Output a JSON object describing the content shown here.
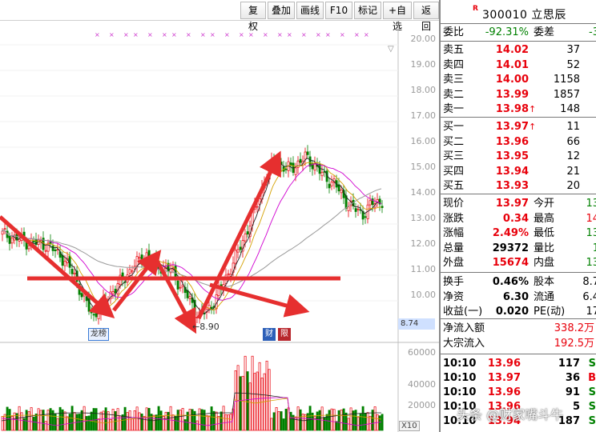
{
  "toolbar": {
    "buttons": [
      "复权",
      "叠加",
      "画线",
      "F10",
      "标记",
      "+自选",
      "返回"
    ],
    "close_glyph": "×"
  },
  "chart": {
    "price_axis": [
      "20.00",
      "19.00",
      "18.00",
      "17.00",
      "16.00",
      "15.00",
      "14.00",
      "13.00",
      "12.00",
      "11.00",
      "10.00"
    ],
    "volume_axis": [
      "60000",
      "40000",
      "20000"
    ],
    "current_price_tag": "8.74",
    "low_label": "←8.90",
    "markers": {
      "dragon": "龙榜",
      "fin": "财",
      "xian": "限"
    },
    "volume_unit": "X10",
    "watermark": "头条 @财家嘴斗牛",
    "colors": {
      "up": "#e8000b",
      "down": "#008000",
      "ma5": "#222222",
      "ma10": "#d4a000",
      "ma20": "#d000d0",
      "ma60": "#999999",
      "annotation": "#e62f2f"
    }
  },
  "quote": {
    "name": "300010 立思辰",
    "badge": "R",
    "weibi": {
      "label": "委比",
      "value": "-92.31%",
      "label2": "委差",
      "value2": "-3"
    },
    "asks": [
      {
        "label": "卖五",
        "price": "14.02",
        "vol": "37"
      },
      {
        "label": "卖四",
        "price": "14.01",
        "vol": "52"
      },
      {
        "label": "卖三",
        "price": "14.00",
        "vol": "1158"
      },
      {
        "label": "卖二",
        "price": "13.99",
        "vol": "1857"
      },
      {
        "label": "卖一",
        "price": "13.98",
        "vol": "148"
      }
    ],
    "bids": [
      {
        "label": "买一",
        "price": "13.97",
        "vol": "11"
      },
      {
        "label": "买二",
        "price": "13.96",
        "vol": "66"
      },
      {
        "label": "买三",
        "price": "13.95",
        "vol": "12"
      },
      {
        "label": "买四",
        "price": "13.94",
        "vol": "21"
      },
      {
        "label": "买五",
        "price": "13.93",
        "vol": "20"
      }
    ],
    "stats": [
      {
        "l1": "现价",
        "v1": "13.97",
        "l2": "今开",
        "v2": "13"
      },
      {
        "l1": "涨跌",
        "v1": "0.34",
        "l2": "最高",
        "v2": "14"
      },
      {
        "l1": "涨幅",
        "v1": "2.49%",
        "l2": "最低",
        "v2": "13"
      },
      {
        "l1": "总量",
        "v1": "29372",
        "l2": "量比",
        "v2": "1"
      },
      {
        "l1": "外盘",
        "v1": "15674",
        "l2": "内盘",
        "v2": "13"
      }
    ],
    "stats2": [
      {
        "l1": "换手",
        "v1": "0.46%",
        "l2": "股本",
        "v2": "8.7"
      },
      {
        "l1": "净资",
        "v1": "6.30",
        "l2": "流通",
        "v2": "6.4"
      },
      {
        "l1": "收益(一)",
        "v1": "0.020",
        "l2": "PE(动)",
        "v2": "17"
      }
    ],
    "flows": [
      {
        "label": "净流入额",
        "value": "338.2万"
      },
      {
        "label": "大宗流入",
        "value": "192.5万"
      }
    ],
    "trades": [
      {
        "time": "10:10",
        "price": "13.96",
        "vol": "117",
        "side": "S"
      },
      {
        "time": "10:10",
        "price": "13.97",
        "vol": "36",
        "side": "B"
      },
      {
        "time": "10:10",
        "price": "13.96",
        "vol": "91",
        "side": "S"
      },
      {
        "time": "10:10",
        "price": "13.96",
        "vol": "5",
        "side": "S"
      },
      {
        "time": "10:10",
        "price": "13.94",
        "vol": "187",
        "side": "S"
      }
    ]
  }
}
